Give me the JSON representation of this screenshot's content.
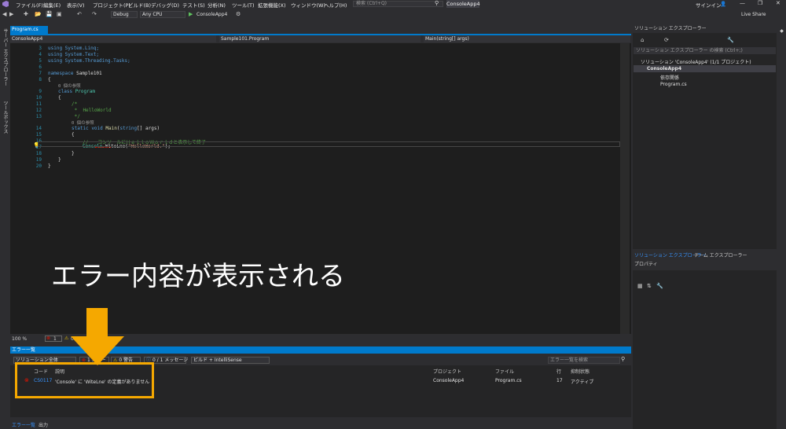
{
  "titlebar": {
    "menus": [
      "ファイル(F)",
      "編集(E)",
      "表示(V)",
      "プロジェクト(P)",
      "ビルド(B)",
      "デバッグ(D)",
      "テスト(S)",
      "分析(N)",
      "ツール(T)",
      "拡張機能(X)",
      "ウィンドウ(W)",
      "ヘルプ(H)"
    ],
    "search_placeholder": "検索 (Ctrl+Q)",
    "app_title": "ConsoleApp4",
    "signin": "サインイン",
    "live_share": "Live Share"
  },
  "toolbar": {
    "config": "Debug",
    "platform": "Any CPU",
    "start_target": "ConsoleApp4"
  },
  "left_strip": {
    "server_explorer": "サーバー エクスプローラー",
    "toolbox": "ツールボックス"
  },
  "editor": {
    "tab": "Program.cs",
    "nav_project": "ConsoleApp4",
    "nav_class": "Sample101.Program",
    "nav_member": "Main(string[] args)",
    "line_numbers": [
      "3",
      "4",
      "5",
      "6",
      "7",
      "8",
      "9",
      "10",
      "11",
      "12",
      "13",
      "14",
      "15",
      "16",
      "17",
      "18",
      "19",
      "20"
    ],
    "lines": {
      "l3": "using System.Linq;",
      "l4": "using System.Text;",
      "l5": "using System.Threading.Tasks;",
      "l7_kw": "namespace",
      "l7_name": "Sample101",
      "ref1": "0 個の参照",
      "l9_kw": "class",
      "l9_name": "Program",
      "l11": "/*",
      "l12": " *  HelloWorld",
      "l13": " */",
      "ref2": "0 個の参照",
      "l14_static": "static",
      "l14_void": "void",
      "l14_main": "Main",
      "l14_params_a": "(",
      "l14_type": "string",
      "l14_params_b": "[] args)",
      "l16": "//　　コンソールにＨｅｌｌｏＷｏｒｌｄと表示して終了",
      "l17_console": "Console",
      "l17_method": ".WiteLne",
      "l17_open": "(",
      "l17_str": "\"HelloWorld.\"",
      "l17_close": ");",
      "open_brace": "{",
      "close_brace": "}"
    },
    "zoom": "100 %",
    "error_count": "1",
    "warning_count": "0"
  },
  "error_list": {
    "title": "エラー一覧",
    "scope": "ソリューション全体",
    "errors_btn": "1 エラー",
    "warnings_btn": "0 警告",
    "messages_btn": "0 / 1 メッセージ",
    "build_filter": "ビルド + IntelliSense",
    "search_placeholder": "エラー一覧を検索",
    "headers": {
      "code": "コード",
      "desc": "説明",
      "project": "プロジェクト",
      "file": "ファイル",
      "line": "行",
      "state": "抑制状態"
    },
    "rows": [
      {
        "code": "CS0117",
        "desc": "'Console' に 'WiteLne' の定義がありません",
        "project": "ConsoleApp4",
        "file": "Program.cs",
        "line": "17",
        "state": "アクティブ"
      }
    ],
    "bottom_tabs": [
      "エラー一覧",
      "出力"
    ]
  },
  "solution_explorer": {
    "title": "ソリューション エクスプローラー",
    "search_placeholder": "ソリューション エクスプローラー の検索 (Ctrl+;)",
    "solution": "ソリューション 'ConsoleApp4' (1/1 プロジェクト)",
    "project": "ConsoleApp4",
    "dependencies": "依存関係",
    "file": "Program.cs",
    "tabs": [
      "ソリューション エクスプローラー",
      "チーム エクスプローラー"
    ]
  },
  "properties": {
    "title": "プロパティ"
  },
  "annotation": {
    "text": "エラー内容が表示される",
    "color": "#f5a800"
  }
}
